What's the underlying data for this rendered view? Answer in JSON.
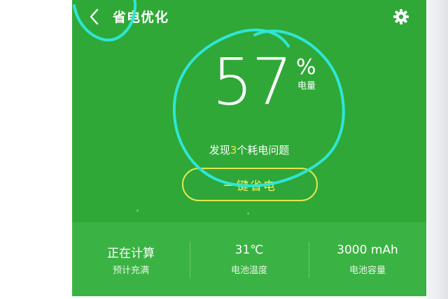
{
  "header": {
    "back_icon": "chevron-left-icon",
    "title": "省电优化",
    "settings_icon": "gear-icon"
  },
  "battery": {
    "percent": "57",
    "percent_sign": "%",
    "caption": "电量"
  },
  "issues": {
    "prefix": "发现",
    "count": "3",
    "suffix": "个耗电问题"
  },
  "optimize_button": {
    "label": "一键省电"
  },
  "stats": [
    {
      "value": "正在计算",
      "label": "预计充满"
    },
    {
      "value": "31℃",
      "label": "电池温度"
    },
    {
      "value": "3000 mAh",
      "label": "电池容量"
    }
  ],
  "colors": {
    "background_green": "#2fa838",
    "stats_green": "#3bb344",
    "accent_yellow": "#f3e74a",
    "annotation_cyan": "#2ee6d6"
  }
}
